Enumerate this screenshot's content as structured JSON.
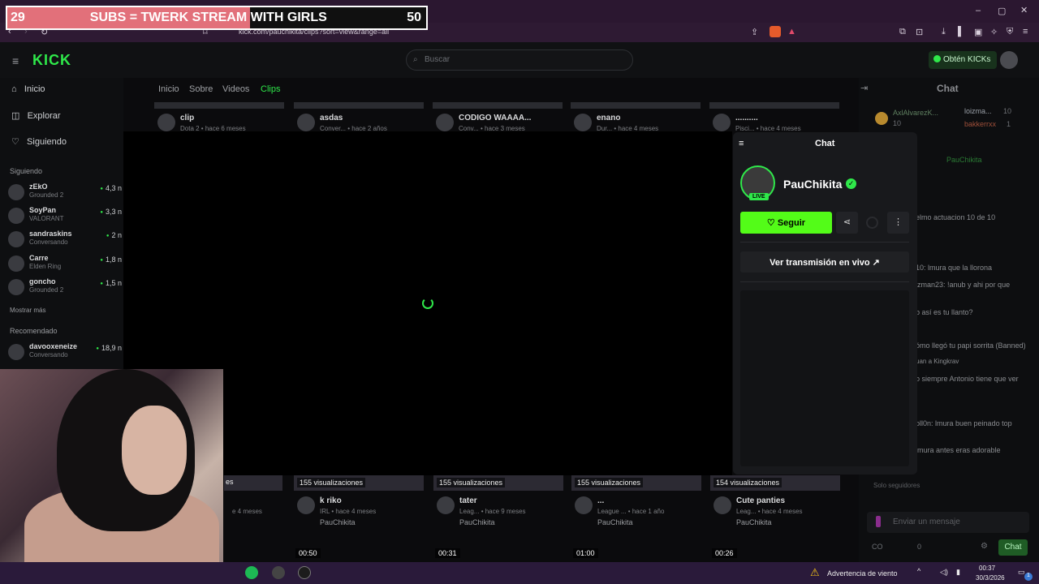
{
  "banner": {
    "left_count": "29",
    "text": "SUBS = TWERK STREAM WITH GIRLS",
    "right_count": "50",
    "progress": 0.58
  },
  "browser": {
    "url": "kick.com/pauchikita/clips?sort=view&range=all"
  },
  "header": {
    "logo": "KICK",
    "search_placeholder": "Buscar",
    "kicks_button": "Obtén KICKs"
  },
  "sidebar": {
    "nav": [
      {
        "label": "Inicio"
      },
      {
        "label": "Explorar"
      },
      {
        "label": "Siguiendo"
      }
    ],
    "following_title": "Siguiendo",
    "following": [
      {
        "name": "zEkO",
        "game": "Grounded 2",
        "viewers": "4,3 n"
      },
      {
        "name": "SoyPan",
        "game": "VALORANT",
        "viewers": "3,3 n"
      },
      {
        "name": "sandraskins",
        "game": "Conversando",
        "viewers": "2 n"
      },
      {
        "name": "Carre",
        "game": "Elden Ring",
        "viewers": "1,8 n"
      },
      {
        "name": "goncho",
        "game": "Grounded 2",
        "viewers": "1,5 n"
      }
    ],
    "show_more": "Mostrar más",
    "recommended_title": "Recomendado",
    "recommended": [
      {
        "name": "davooxeneize",
        "game": "Conversando",
        "viewers": "18,9 n"
      }
    ]
  },
  "tabs": [
    {
      "label": "Inicio"
    },
    {
      "label": "Sobre"
    },
    {
      "label": "Videos"
    },
    {
      "label": "Clips"
    }
  ],
  "clips_top": [
    {
      "title": "clip",
      "sub": "Dota 2 • hace 6 meses"
    },
    {
      "title": "asdas",
      "sub": "Conver... • hace 2 años"
    },
    {
      "title": "CODIGO WAAAA...",
      "sub": "Conv... • hace 3 meses"
    },
    {
      "title": "enano",
      "sub": "Dur... • hace 4 meses"
    },
    {
      "title": "..........",
      "sub": "Pisci... • hace 4 meses"
    }
  ],
  "clips_bottom": [
    {
      "views": "155 visualizaciones",
      "title": "k riko",
      "sub": "IRL • hace 4 meses",
      "channel": "PauChikita"
    },
    {
      "views": "155 visualizaciones",
      "title": "tater",
      "sub": "Leag... • hace 9 meses",
      "channel": "PauChikita"
    },
    {
      "views": "155 visualizaciones",
      "title": "...",
      "sub": "League ... • hace 1 año",
      "channel": "PauChikita"
    },
    {
      "views": "154 visualizaciones",
      "title": "Cute panties",
      "sub": "Leag... • hace 4 meses",
      "channel": "PauChikita"
    }
  ],
  "clips_partial": {
    "views_fragment": "es",
    "sub_fragment": "e 4 meses"
  },
  "durations": [
    "00:50",
    "00:31",
    "01:00",
    "00:26"
  ],
  "card": {
    "title": "Chat",
    "name": "PauChikita",
    "live": "LIVE",
    "follow": "Seguir",
    "watch": "Ver transmisión en vivo"
  },
  "chat": {
    "title": "Chat",
    "top_users": [
      {
        "name": "AxlAlvarezK...",
        "count": "10"
      },
      {
        "name": "loizma...",
        "count": "10"
      },
      {
        "name": "bakkerrxx",
        "count": "1"
      }
    ],
    "pinned_user": "PauChikita",
    "messages": [
      "elmo actuacion 10 de 10",
      "10: lmura que la llorona",
      "lzman23: !anub y ahi por que",
      "b así es tu llanto?",
      "ómo llegó tu papi sorrita (Banned)",
      "uan a Kingkrav",
      "o siempre Antonio tiene que ver",
      "oll0n: lmura buen peinado top",
      "lmura antes eras adorable"
    ],
    "followers_only": "Solo seguidores",
    "input_placeholder": "Enviar un mensaje",
    "send": "Chat",
    "counts": [
      "CO",
      "0"
    ]
  },
  "taskbar": {
    "weather": "Advertencia de viento",
    "time": "00:37",
    "date": "30/3/2026",
    "notifications": "1"
  }
}
